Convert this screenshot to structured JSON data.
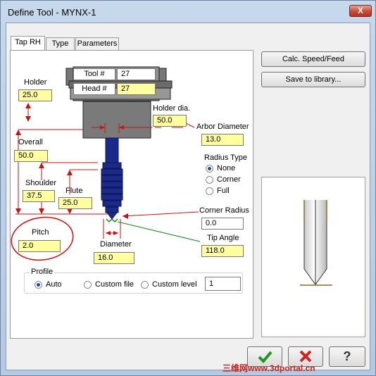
{
  "window": {
    "title": "Define Tool - MYNX-1",
    "close_label": "X"
  },
  "tabs": [
    {
      "label": "Tap RH"
    },
    {
      "label": "Type"
    },
    {
      "label": "Parameters"
    }
  ],
  "buttons": {
    "calc": "Calc. Speed/Feed",
    "save_library": "Save to library...",
    "ok_icon": "check-icon",
    "cancel_icon": "x-icon",
    "help_icon": "question-icon"
  },
  "holder_head": {
    "tool_label": "Tool #",
    "tool_value": "27",
    "head_label": "Head #",
    "head_value": "27"
  },
  "fields": {
    "holder": {
      "label": "Holder",
      "value": "25.0"
    },
    "holder_dia": {
      "label": "Holder dia.",
      "value": "50.0"
    },
    "arbor_diameter": {
      "label": "Arbor Diameter",
      "value": "13.0"
    },
    "overall": {
      "label": "Overall",
      "value": "50.0"
    },
    "shoulder": {
      "label": "Shoulder",
      "value": "37.5"
    },
    "flute": {
      "label": "Flute",
      "value": "25.0"
    },
    "corner_radius": {
      "label": "Corner Radius",
      "value": "0.0"
    },
    "tip_angle": {
      "label": "Tip Angle",
      "value": "118.0"
    },
    "pitch": {
      "label": "Pitch",
      "value": "2.0"
    },
    "diameter": {
      "label": "Diameter",
      "value": "16.0"
    }
  },
  "radius_type": {
    "label": "Radius Type",
    "options": [
      "None",
      "Corner",
      "Full"
    ],
    "selected": "None"
  },
  "profile": {
    "label": "Profile",
    "options": [
      "Auto",
      "Custom file",
      "Custom level"
    ],
    "selected": "Auto",
    "level_value": "1"
  },
  "watermark": "三维网www.3dportal.cn",
  "colors": {
    "field_bg": "#ffffa0",
    "annotation_red": "#cc1111",
    "tool_blue": "#1a2a8a",
    "highlight_circle": "#d01818"
  }
}
